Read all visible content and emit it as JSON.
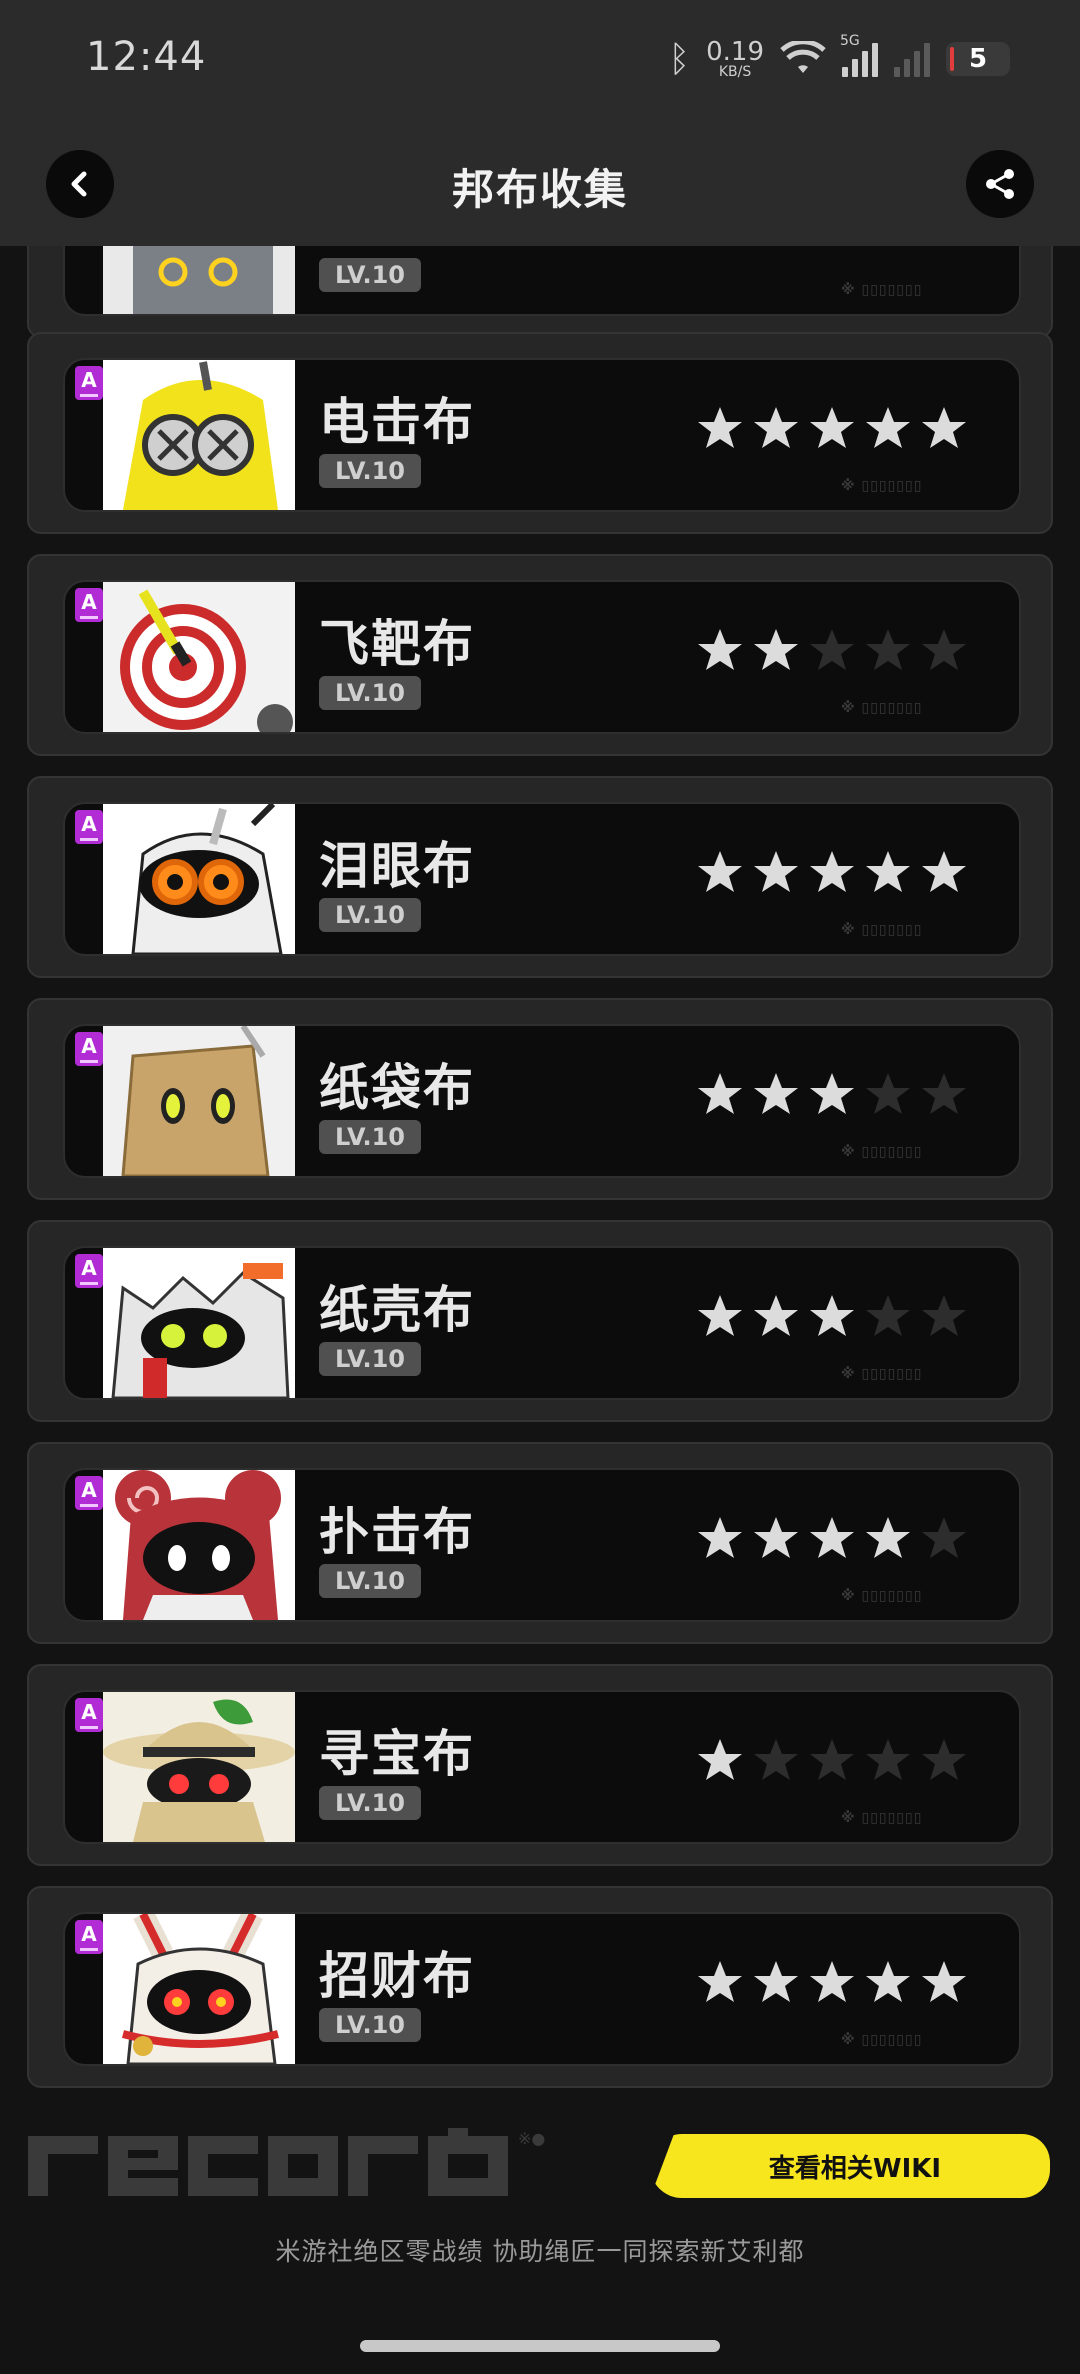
{
  "status_bar": {
    "time": "12:44",
    "net_speed": "0.19",
    "net_unit": "KB/S",
    "network": "5G",
    "battery": "5"
  },
  "header": {
    "title": "邦布收集",
    "back_icon": "chevron-left-icon",
    "share_icon": "share-icon"
  },
  "partial_card": {
    "level": "LV.10",
    "deco": "※ ▯▯▯▯▯▯▯"
  },
  "bangboos": [
    {
      "name": "电击布",
      "level": "LV.10",
      "rank": "A",
      "stars": 5,
      "deco": "※ ▯▯▯▯▯▯▯",
      "art": "eletric"
    },
    {
      "name": "飞靶布",
      "level": "LV.10",
      "rank": "A",
      "stars": 2,
      "deco": "※ ▯▯▯▯▯▯▯",
      "art": "target"
    },
    {
      "name": "泪眼布",
      "level": "LV.10",
      "rank": "A",
      "stars": 5,
      "deco": "※ ▯▯▯▯▯▯▯",
      "art": "tear"
    },
    {
      "name": "纸袋布",
      "level": "LV.10",
      "rank": "A",
      "stars": 3,
      "deco": "※ ▯▯▯▯▯▯▯",
      "art": "bag"
    },
    {
      "name": "纸壳布",
      "level": "LV.10",
      "rank": "A",
      "stars": 3,
      "deco": "※ ▯▯▯▯▯▯▯",
      "art": "shell"
    },
    {
      "name": "扑击布",
      "level": "LV.10",
      "rank": "A",
      "stars": 4,
      "deco": "※ ▯▯▯▯▯▯▯",
      "art": "bear"
    },
    {
      "name": "寻宝布",
      "level": "LV.10",
      "rank": "A",
      "stars": 1,
      "deco": "※ ▯▯▯▯▯▯▯",
      "art": "explorer"
    },
    {
      "name": "招财布",
      "level": "LV.10",
      "rank": "A",
      "stars": 5,
      "deco": "※ ▯▯▯▯▯▯▯",
      "art": "lucky"
    }
  ],
  "stars_total": 5,
  "footer": {
    "logo_text": "record",
    "wiki_button": "查看相关WIKI",
    "tagline": "米游社绝区零战绩 协助绳匠一同探索新艾利都"
  },
  "colors": {
    "accent_yellow": "#f7e51e",
    "rank_purple": "#b22cd6",
    "star_on": "#dcdcdc",
    "star_off": "#2d2d2d",
    "background": "#131313"
  }
}
